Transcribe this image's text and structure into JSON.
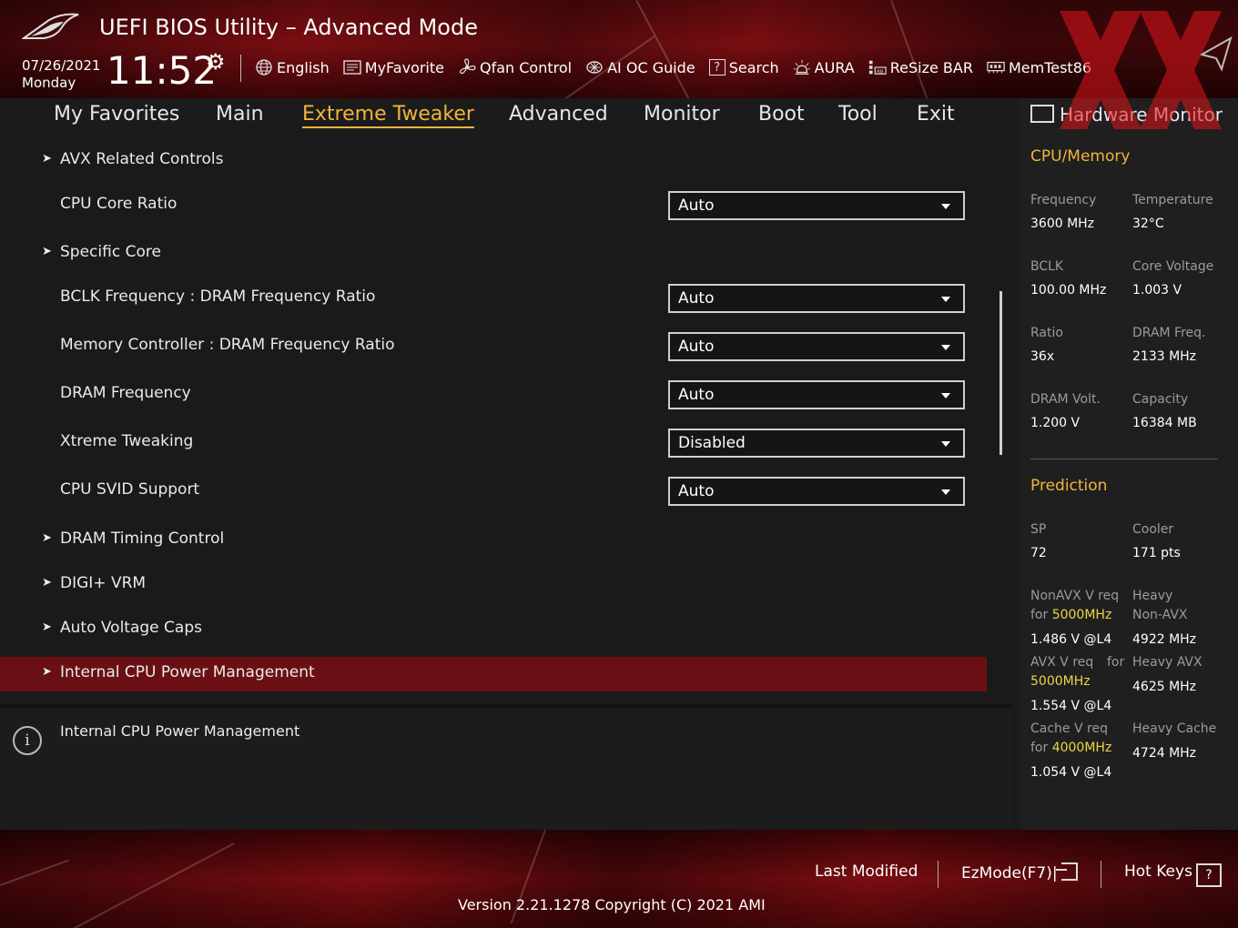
{
  "header": {
    "title": "UEFI BIOS Utility – Advanced Mode",
    "date": "07/26/2021",
    "day": "Monday",
    "time": "11:52",
    "toolbar": [
      {
        "label": "English",
        "icon": "globe-icon"
      },
      {
        "label": "MyFavorite",
        "icon": "favorite-list-icon"
      },
      {
        "label": "Qfan Control",
        "icon": "fan-icon"
      },
      {
        "label": "AI OC Guide",
        "icon": "chip-icon"
      },
      {
        "label": "Search",
        "icon": "search-help-icon"
      },
      {
        "label": "AURA",
        "icon": "aura-light-icon"
      },
      {
        "label": "ReSize BAR",
        "icon": "resize-bar-icon"
      },
      {
        "label": "MemTest86",
        "icon": "memory-icon"
      }
    ]
  },
  "nav": {
    "tabs": [
      "My Favorites",
      "Main",
      "Extreme Tweaker",
      "Advanced",
      "Monitor",
      "Boot",
      "Tool",
      "Exit"
    ],
    "active": "Extreme Tweaker"
  },
  "settings": [
    {
      "label": "AVX Related Controls",
      "submenu": true
    },
    {
      "label": "CPU Core Ratio",
      "value": "Auto"
    },
    {
      "label": "Specific Core",
      "submenu": true
    },
    {
      "label": "BCLK Frequency : DRAM Frequency Ratio",
      "value": "Auto"
    },
    {
      "label": "Memory Controller : DRAM Frequency Ratio",
      "value": "Auto"
    },
    {
      "label": "DRAM Frequency",
      "value": "Auto"
    },
    {
      "label": "Xtreme Tweaking",
      "value": "Disabled"
    },
    {
      "label": "CPU SVID Support",
      "value": "Auto"
    },
    {
      "label": "DRAM Timing Control",
      "submenu": true
    },
    {
      "label": "DIGI+ VRM",
      "submenu": true
    },
    {
      "label": "Auto Voltage Caps",
      "submenu": true
    },
    {
      "label": "Internal CPU Power Management",
      "submenu": true,
      "selected": true
    }
  ],
  "help": {
    "text": "Internal CPU Power Management"
  },
  "hw_monitor": {
    "title": "Hardware Monitor",
    "cpu_memory": {
      "heading": "CPU/Memory",
      "frequency_label": "Frequency",
      "frequency": "3600 MHz",
      "temperature_label": "Temperature",
      "temperature": "32°C",
      "bclk_label": "BCLK",
      "bclk": "100.00 MHz",
      "core_voltage_label": "Core Voltage",
      "core_voltage": "1.003 V",
      "ratio_label": "Ratio",
      "ratio": "36x",
      "dram_freq_label": "DRAM Freq.",
      "dram_freq": "2133 MHz",
      "dram_volt_label": "DRAM Volt.",
      "dram_volt": "1.200 V",
      "capacity_label": "Capacity",
      "capacity": "16384 MB"
    },
    "prediction": {
      "heading": "Prediction",
      "sp_label": "SP",
      "sp": "72",
      "cooler_label": "Cooler",
      "cooler": "171 pts",
      "nonavx_label_1": "NonAVX V req",
      "nonavx_label_2": "for",
      "nonavx_freq": "5000MHz",
      "nonavx_value": "1.486 V @L4",
      "heavy_nonavx_label_1": "Heavy",
      "heavy_nonavx_label_2": "Non-AVX",
      "heavy_nonavx_value": "4922 MHz",
      "avx_label_1": "AVX V req",
      "avx_label_2": "for",
      "avx_freq": "5000MHz",
      "avx_value": "1.554 V @L4",
      "heavy_avx_label": "Heavy AVX",
      "heavy_avx_value": "4625 MHz",
      "cache_label_1": "Cache V req",
      "cache_label_2": "for",
      "cache_freq": "4000MHz",
      "cache_value": "1.054 V @L4",
      "heavy_cache_label": "Heavy Cache",
      "heavy_cache_value": "4724 MHz"
    }
  },
  "footer": {
    "last_modified": "Last Modified",
    "ezmode": "EzMode(F7)|",
    "hot_keys": "Hot Keys",
    "hot_keys_icon": "?",
    "version": "Version 2.21.1278 Copyright (C) 2021 AMI"
  },
  "colors": {
    "accent": "#f1b43c",
    "selected_row": "#6a1014",
    "highlight_freq": "#e8d84a"
  }
}
